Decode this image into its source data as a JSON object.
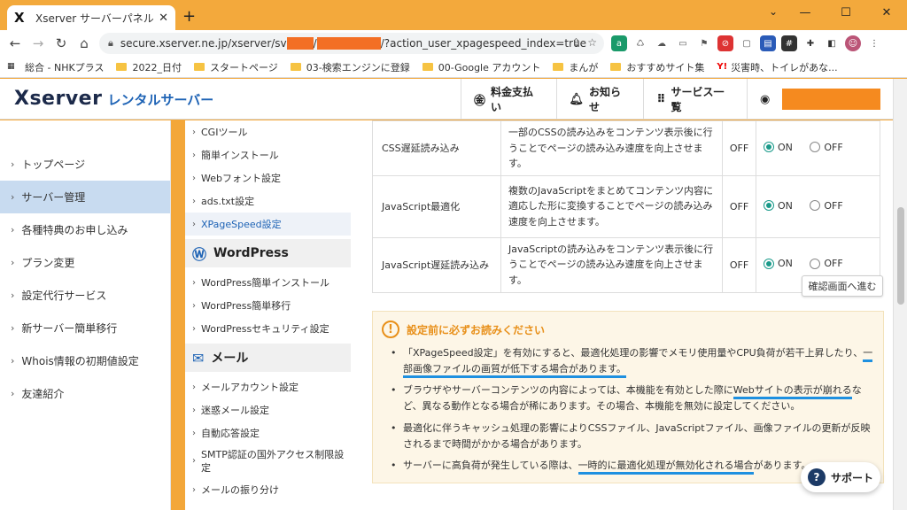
{
  "browser": {
    "tab_title": "Xserver サーバーパネル",
    "tab_favicon": "X",
    "url_prefix": "secure.xserver.ne.jp/xserver/sv",
    "url_suffix": "/?action_user_xpagespeed_index=true",
    "bookmarks": [
      {
        "label": "総合 - NHKプラス",
        "icon": "nhk"
      },
      {
        "label": "2022_日付",
        "icon": "folder"
      },
      {
        "label": "スタートページ",
        "icon": "folder"
      },
      {
        "label": "03-検索エンジンに登録",
        "icon": "folder"
      },
      {
        "label": "00-Google アカウント",
        "icon": "folder"
      },
      {
        "label": "まんが",
        "icon": "folder"
      },
      {
        "label": "おすすめサイト集",
        "icon": "folder"
      },
      {
        "label": "災害時、トイレがあな...",
        "icon": "yahoo"
      }
    ]
  },
  "header": {
    "brand": "Xserver",
    "brand_sub": "レンタルサーバー",
    "nav": [
      {
        "label": "料金支払い",
        "icon": "yen-icon"
      },
      {
        "label": "お知らせ",
        "icon": "bell-icon"
      },
      {
        "label": "サービス一覧",
        "icon": "grid-icon"
      }
    ]
  },
  "sidebar": {
    "items": [
      {
        "label": "トップページ"
      },
      {
        "label": "サーバー管理",
        "active": true
      },
      {
        "label": "各種特典のお申し込み"
      },
      {
        "label": "プラン変更"
      },
      {
        "label": "設定代行サービス"
      },
      {
        "label": "新サーバー簡単移行"
      },
      {
        "label": "Whois情報の初期値設定"
      },
      {
        "label": "友達紹介"
      }
    ]
  },
  "submenu": {
    "items_top": [
      "CGIツール",
      "簡単インストール",
      "Webフォント設定",
      "ads.txt設定",
      "XPageSpeed設定"
    ],
    "wordpress_head": "WordPress",
    "wordpress_items": [
      "WordPress簡単インストール",
      "WordPress簡単移行",
      "WordPressセキュリティ設定"
    ],
    "mail_head": "メール",
    "mail_items": [
      "メールアカウント設定",
      "迷惑メール設定",
      "自動応答設定",
      "SMTP認証の国外アクセス制限設定",
      "メールの振り分け"
    ]
  },
  "settings": {
    "rows": [
      {
        "name": "CSS遅延読み込み",
        "desc": "一部のCSSの読み込みをコンテンツ表示後に行うことでページの読み込み速度を向上させます。",
        "status": "OFF",
        "on": "ON",
        "off": "OFF"
      },
      {
        "name": "JavaScript最適化",
        "desc": "複数のJavaScriptをまとめてコンテンツ内容に適応した形に変換することでページの読み込み速度を向上させます。",
        "status": "OFF",
        "on": "ON",
        "off": "OFF"
      },
      {
        "name": "JavaScript遅延読み込み",
        "desc": "JavaScriptの読み込みをコンテンツ表示後に行うことでページの読み込み速度を向上させます。",
        "status": "OFF",
        "on": "ON",
        "off": "OFF"
      }
    ],
    "confirm_label": "確認画面へ進む"
  },
  "notice": {
    "title": "設定前に必ずお読みください",
    "items": [
      {
        "pre": "「XPageSpeed設定」を有効にすると、最適化処理の影響でメモリ使用量やCPU負荷が若干上昇したり、",
        "ul": "一部画像ファイルの画質が低下する場合があります。",
        "post": ""
      },
      {
        "pre": "ブラウザやサーバーコンテンツの内容によっては、本機能を有効とした際に",
        "ul": "Webサイトの表示が崩れる",
        "post": "など、異なる動作となる場合が稀にあります。その場合、本機能を無効に設定してください。"
      },
      {
        "pre": "最適化に伴うキャッシュ処理の影響によりCSSファイル、JavaScriptファイル、画像ファイルの更新が反映されるまで時間がかかる場合があります。",
        "ul": "",
        "post": ""
      },
      {
        "pre": "サーバーに高負荷が発生している際は、",
        "ul": "一時的に最適化処理が無効化される場合",
        "post": "があります。"
      }
    ]
  },
  "support_label": "サポート",
  "colors": {
    "accent": "#1e63b5",
    "chrome": "#f3a93c",
    "on_radio": "#1a9a8a",
    "warning": "#e8901a",
    "underline": "#1e90e0"
  }
}
